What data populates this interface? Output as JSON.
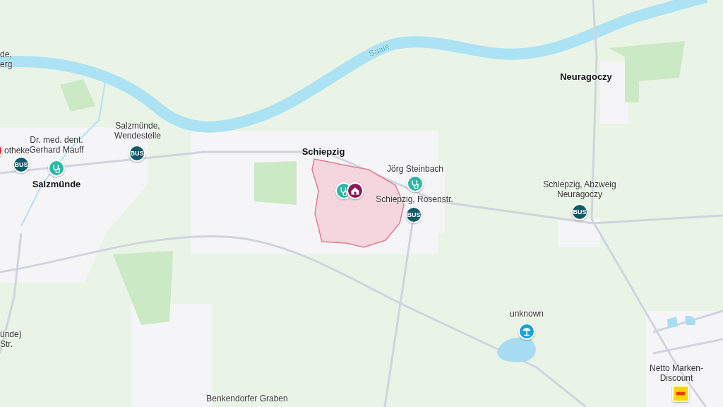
{
  "map": {
    "labels": [
      {
        "text": "de,\nerg",
        "kind": "place"
      },
      {
        "text": "Saale",
        "kind": "river"
      },
      {
        "text": "Neuragoczy",
        "kind": "town"
      },
      {
        "text": "otheke",
        "kind": "place"
      },
      {
        "text": "Dr. med. dent.\nGerhard Mauff",
        "kind": "place"
      },
      {
        "text": "Salzmünde,\nWendestelle",
        "kind": "place"
      },
      {
        "text": "Salzmünde",
        "kind": "town"
      },
      {
        "text": "Schiepzig",
        "kind": "town"
      },
      {
        "text": "Jörg Steinbach",
        "kind": "place"
      },
      {
        "text": "Schiepzig, Rosenstr.",
        "kind": "place"
      },
      {
        "text": "Schiepzig, Abzweig\nNeuragoczy",
        "kind": "place"
      },
      {
        "text": "unknown",
        "kind": "place"
      },
      {
        "text": "ünde)\nStr.",
        "kind": "place"
      },
      {
        "text": "Netto Marken-\nDiscount",
        "kind": "place"
      },
      {
        "text": "Benkendorfer Graben",
        "kind": "stream"
      }
    ],
    "markers": [
      {
        "kind": "pharmacy"
      },
      {
        "kind": "bus",
        "text": "BUS"
      },
      {
        "kind": "doctor"
      },
      {
        "kind": "bus",
        "text": "BUS"
      },
      {
        "kind": "doctor"
      },
      {
        "kind": "home"
      },
      {
        "kind": "doctor"
      },
      {
        "kind": "bus",
        "text": "BUS"
      },
      {
        "kind": "bus",
        "text": "BUS"
      },
      {
        "kind": "beach"
      },
      {
        "kind": "shop"
      }
    ]
  }
}
